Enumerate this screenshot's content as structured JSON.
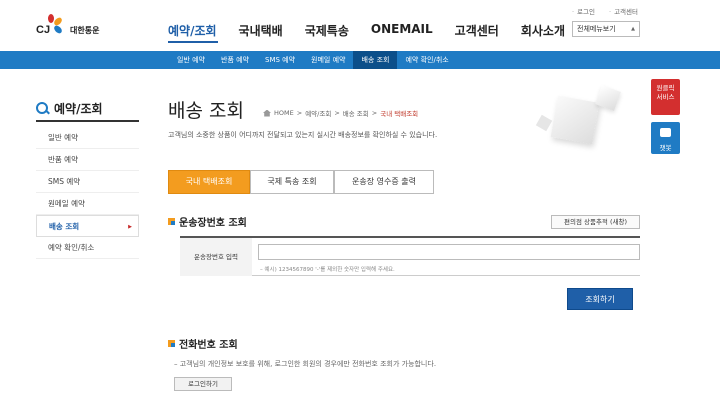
{
  "header": {
    "brand_mark": "CJ",
    "brand_name": "대한통운",
    "util_links": [
      "로그인",
      "고객센터"
    ],
    "gnb": [
      "예약/조회",
      "국내택배",
      "국제특송",
      "ONEMAIL",
      "고객센터",
      "회사소개"
    ],
    "all_menu": "전체메뉴보기"
  },
  "subnav": [
    "일반 예약",
    "반품 예약",
    "SMS 예약",
    "원메일 예약",
    "배송 조회",
    "예약 확인/취소"
  ],
  "lnb": {
    "title": "예약/조회",
    "items": [
      "일반 예약",
      "반품 예약",
      "SMS 예약",
      "원메일 예약",
      "배송 조회",
      "예약 확인/취소"
    ]
  },
  "main": {
    "title": "배송 조회",
    "breadcrumb": [
      "HOME",
      "예약/조회",
      "배송 조회",
      "국내 택배조회"
    ],
    "lead": "고객님의 소중한 상품이 어디까지 전달되고 있는지 실시간 배송정보를 확인하실 수 있습니다.",
    "tabs": [
      "국내 택배조회",
      "국제 특송 조회",
      "운송장 영수증 출력"
    ],
    "section1": {
      "title": "운송장번호 조회",
      "side_button": "편의점 상품추적 (새창)",
      "label": "운송장번호 입력",
      "input_value": "",
      "hint": "– 예시) 1234567890 '-'를 제외한 숫자만 입력해 주세요.",
      "submit": "조회하기"
    },
    "section2": {
      "title": "전화번호 조회",
      "note": "– 고객님의 개인정보 보호를 위해, 로그인한 회원의 경우에만 전화번호 조회가 가능합니다.",
      "login_button": "로그인하기"
    }
  },
  "widgets": {
    "oneclick": [
      "원클릭",
      "서비스"
    ],
    "chatbot": "챗봇"
  },
  "colors": {
    "primary_blue": "#1f7bc4",
    "dark_blue": "#1f5fa8",
    "orange": "#f39c1f",
    "red": "#d32f2f"
  }
}
